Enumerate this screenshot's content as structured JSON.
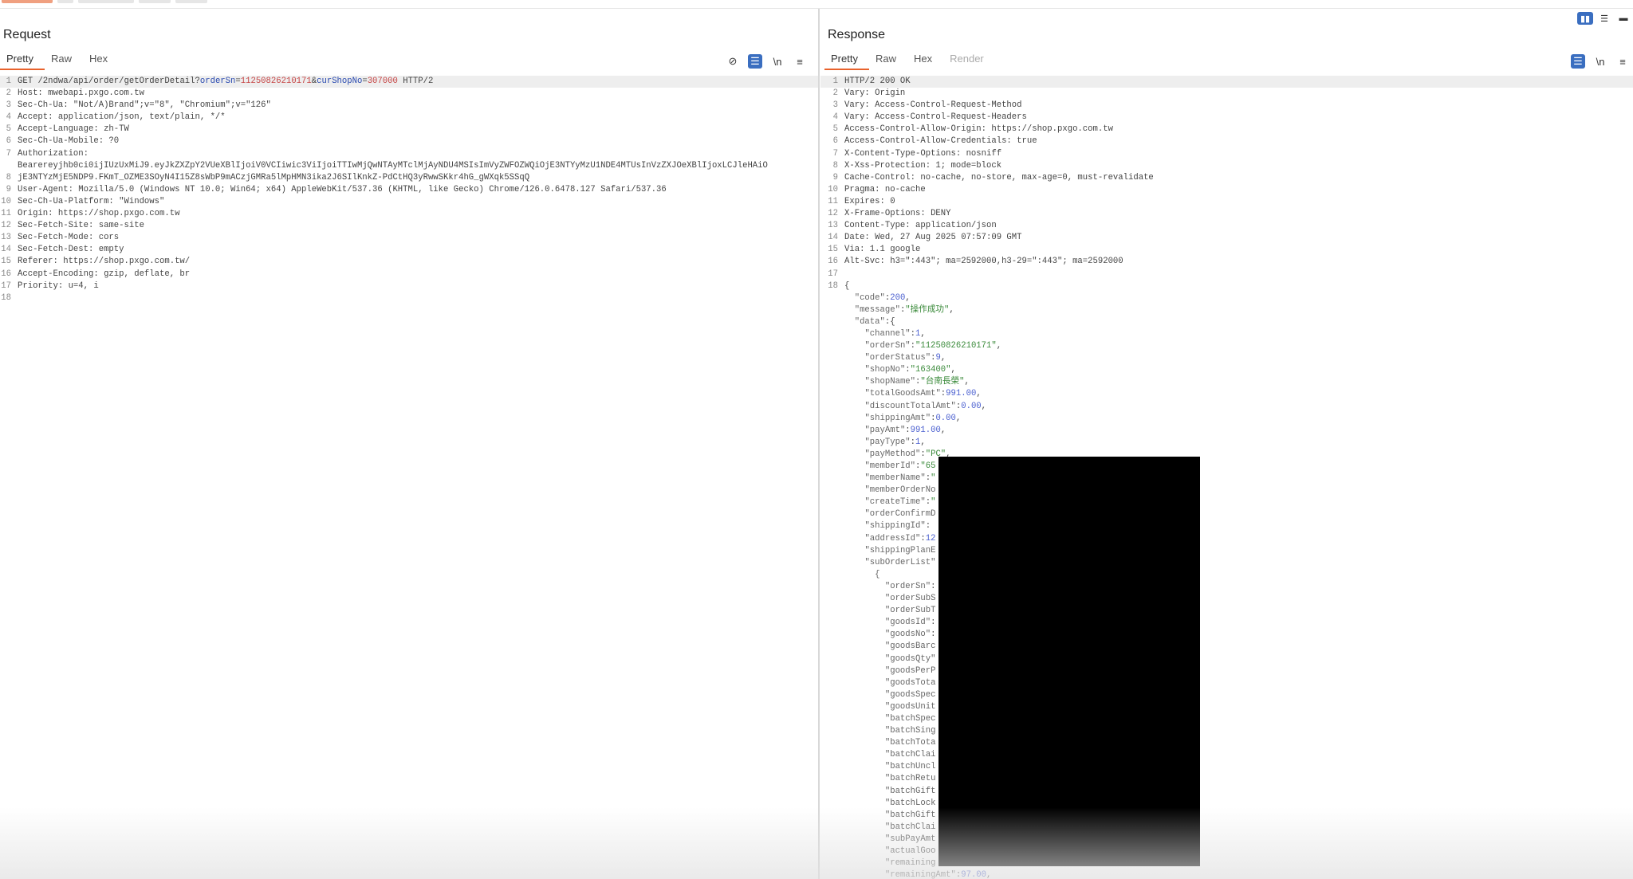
{
  "top_tabs": [
    "",
    "",
    "",
    "",
    ""
  ],
  "layout_buttons": [
    "▮▮",
    "☰",
    "▬"
  ],
  "request": {
    "title": "Request",
    "tabs": [
      "Pretty",
      "Raw",
      "Hex"
    ],
    "toolbar": [
      "⊘",
      "☰",
      "\\n",
      "≡"
    ],
    "request_line": {
      "method": "GET",
      "path": "/2ndwa/api/order/getOrderDetail?",
      "p1_key": "orderSn",
      "p1_val": "11250826210171",
      "p2_key": "curShopNo",
      "p2_val": "307000",
      "protocol": "HTTP/2"
    },
    "lines": [
      "Host: mwebapi.pxgo.com.tw",
      "Sec-Ch-Ua: \"Not/A)Brand\";v=\"8\", \"Chromium\";v=\"126\"",
      "Accept: application/json, text/plain, */*",
      "Accept-Language: zh-TW",
      "Sec-Ch-Ua-Mobile: ?0",
      "Authorization:",
      "Bearereyjhb0ci0ijIUzUxMiJ9.eyJkZXZpY2VUeXBlIjoiV0VCIiwic3ViIjoiTTIwMjQwNTAyMTclMjAyNDU4MSIsImVyZWFOZWQiOjE3NTYyMzU1NDE4MTUsInVzZXJOeXBlIjoxLCJleHAiO",
      "jE3NTYzMjE5NDP9.FKmT_OZME3SOyN4I15Z8sWbP9mACzjGMRa5lMpHMN3ika2J6SIlKnkZ-PdCtHQ3yRwwSKkr4hG_gWXqk5SSqQ",
      "User-Agent: Mozilla/5.0 (Windows NT 10.0; Win64; x64) AppleWebKit/537.36 (KHTML, like Gecko) Chrome/126.0.6478.127 Safari/537.36",
      "Sec-Ch-Ua-Platform: \"Windows\"",
      "Origin: https://shop.pxgo.com.tw",
      "Sec-Fetch-Site: same-site",
      "Sec-Fetch-Mode: cors",
      "Sec-Fetch-Dest: empty",
      "Referer: https://shop.pxgo.com.tw/",
      "Accept-Encoding: gzip, deflate, br",
      "Priority: u=4, i",
      "",
      ""
    ],
    "line_numbers": [
      "1",
      "2",
      "3",
      "4",
      "5",
      "6",
      "7",
      "",
      "8",
      "9",
      "10",
      "11",
      "12",
      "13",
      "14",
      "15",
      "16",
      "17",
      "18"
    ]
  },
  "response": {
    "title": "Response",
    "tabs": [
      "Pretty",
      "Raw",
      "Hex",
      "Render"
    ],
    "toolbar": [
      "☰",
      "\\n",
      "≡"
    ],
    "headers": [
      "HTTP/2 200 OK",
      "Vary: Origin",
      "Vary: Access-Control-Request-Method",
      "Vary: Access-Control-Request-Headers",
      "Access-Control-Allow-Origin: https://shop.pxgo.com.tw",
      "Access-Control-Allow-Credentials: true",
      "X-Content-Type-Options: nosniff",
      "X-Xss-Protection: 1; mode=block",
      "Cache-Control: no-cache, no-store, max-age=0, must-revalidate",
      "Pragma: no-cache",
      "Expires: 0",
      "X-Frame-Options: DENY",
      "Content-Type: application/json",
      "Date: Wed, 27 Aug 2025 07:57:09 GMT",
      "Via: 1.1 google",
      "Alt-Svc: h3=\":443\"; ma=2592000,h3-29=\":443\"; ma=2592000",
      "",
      "{"
    ],
    "json_lines": [
      {
        "indent": 1,
        "key": "\"code\"",
        "sep": ":",
        "val": "200",
        "t": "n",
        "end": ","
      },
      {
        "indent": 1,
        "key": "\"message\"",
        "sep": ":",
        "val": "\"操作成功\"",
        "t": "s",
        "end": ","
      },
      {
        "indent": 1,
        "key": "\"data\"",
        "sep": ":{",
        "val": "",
        "t": "",
        "end": ""
      },
      {
        "indent": 2,
        "key": "\"channel\"",
        "sep": ":",
        "val": "1",
        "t": "n",
        "end": ","
      },
      {
        "indent": 2,
        "key": "\"orderSn\"",
        "sep": ":",
        "val": "\"11250826210171\"",
        "t": "s",
        "end": ","
      },
      {
        "indent": 2,
        "key": "\"orderStatus\"",
        "sep": ":",
        "val": "9",
        "t": "n",
        "end": ","
      },
      {
        "indent": 2,
        "key": "\"shopNo\"",
        "sep": ":",
        "val": "\"163400\"",
        "t": "s",
        "end": ","
      },
      {
        "indent": 2,
        "key": "\"shopName\"",
        "sep": ":",
        "val": "\"台南長榮\"",
        "t": "s",
        "end": ","
      },
      {
        "indent": 2,
        "key": "\"totalGoodsAmt\"",
        "sep": ":",
        "val": "991.00",
        "t": "n",
        "end": ","
      },
      {
        "indent": 2,
        "key": "\"discountTotalAmt\"",
        "sep": ":",
        "val": "0.00",
        "t": "n",
        "end": ","
      },
      {
        "indent": 2,
        "key": "\"shippingAmt\"",
        "sep": ":",
        "val": "0.00",
        "t": "n",
        "end": ","
      },
      {
        "indent": 2,
        "key": "\"payAmt\"",
        "sep": ":",
        "val": "991.00",
        "t": "n",
        "end": ","
      },
      {
        "indent": 2,
        "key": "\"payType\"",
        "sep": ":",
        "val": "1",
        "t": "n",
        "end": ","
      },
      {
        "indent": 2,
        "key": "\"payMethod\"",
        "sep": ":",
        "val": "\"PC\"",
        "t": "s",
        "end": ","
      },
      {
        "indent": 2,
        "key": "\"memberId\"",
        "sep": ":",
        "val": "\"65",
        "t": "s",
        "end": ""
      },
      {
        "indent": 2,
        "key": "\"memberName\"",
        "sep": ":",
        "val": "\"",
        "t": "s",
        "end": ""
      },
      {
        "indent": 2,
        "key": "\"memberOrderNo",
        "sep": "",
        "val": "",
        "t": "",
        "end": ""
      },
      {
        "indent": 2,
        "key": "\"createTime\"",
        "sep": ":",
        "val": "\"",
        "t": "s",
        "end": ""
      },
      {
        "indent": 2,
        "key": "\"orderConfirmD",
        "sep": "",
        "val": "",
        "t": "",
        "end": ""
      },
      {
        "indent": 2,
        "key": "\"shippingId\"",
        "sep": ":",
        "val": "",
        "t": "",
        "end": ""
      },
      {
        "indent": 2,
        "key": "\"addressId\"",
        "sep": ":",
        "val": "12",
        "t": "n",
        "end": ""
      },
      {
        "indent": 2,
        "key": "\"shippingPlanE",
        "sep": "",
        "val": "",
        "t": "",
        "end": ""
      },
      {
        "indent": 2,
        "key": "\"subOrderList\"",
        "sep": "",
        "val": "",
        "t": "",
        "end": ""
      },
      {
        "indent": 3,
        "key": "{",
        "sep": "",
        "val": "",
        "t": "",
        "end": ""
      },
      {
        "indent": 4,
        "key": "\"orderSn\"",
        "sep": ":",
        "val": "",
        "t": "",
        "end": ""
      },
      {
        "indent": 4,
        "key": "\"orderSubS",
        "sep": "",
        "val": "",
        "t": "",
        "end": ""
      },
      {
        "indent": 4,
        "key": "\"orderSubT",
        "sep": "",
        "val": "",
        "t": "",
        "end": ""
      },
      {
        "indent": 4,
        "key": "\"goodsId\"",
        "sep": ":",
        "val": "",
        "t": "",
        "end": ""
      },
      {
        "indent": 4,
        "key": "\"goodsNo\"",
        "sep": ":",
        "val": "",
        "t": "",
        "end": ""
      },
      {
        "indent": 4,
        "key": "\"goodsBarc",
        "sep": "",
        "val": "",
        "t": "",
        "end": ""
      },
      {
        "indent": 4,
        "key": "\"goodsQty\"",
        "sep": "",
        "val": "",
        "t": "",
        "end": ""
      },
      {
        "indent": 4,
        "key": "\"goodsPerP",
        "sep": "",
        "val": "",
        "t": "",
        "end": ""
      },
      {
        "indent": 4,
        "key": "\"goodsTota",
        "sep": "",
        "val": "",
        "t": "",
        "end": ""
      },
      {
        "indent": 4,
        "key": "\"goodsSpec",
        "sep": "",
        "val": "",
        "t": "",
        "end": ""
      },
      {
        "indent": 4,
        "key": "\"goodsUnit",
        "sep": "",
        "val": "",
        "t": "",
        "end": ""
      },
      {
        "indent": 4,
        "key": "\"batchSpec",
        "sep": "",
        "val": "",
        "t": "",
        "end": ""
      },
      {
        "indent": 4,
        "key": "\"batchSing",
        "sep": "",
        "val": "",
        "t": "",
        "end": ""
      },
      {
        "indent": 4,
        "key": "\"batchTota",
        "sep": "",
        "val": "",
        "t": "",
        "end": ""
      },
      {
        "indent": 4,
        "key": "\"batchClai",
        "sep": "",
        "val": "",
        "t": "",
        "end": ""
      },
      {
        "indent": 4,
        "key": "\"batchUncl",
        "sep": "",
        "val": "",
        "t": "",
        "end": ""
      },
      {
        "indent": 4,
        "key": "\"batchRetu",
        "sep": "",
        "val": "",
        "t": "",
        "end": ""
      },
      {
        "indent": 4,
        "key": "\"batchGift",
        "sep": "",
        "val": "",
        "t": "",
        "end": ""
      },
      {
        "indent": 4,
        "key": "\"batchLock",
        "sep": "",
        "val": "",
        "t": "",
        "end": ""
      },
      {
        "indent": 4,
        "key": "\"batchGift",
        "sep": "",
        "val": "",
        "t": "",
        "end": ""
      },
      {
        "indent": 4,
        "key": "\"batchClai",
        "sep": "",
        "val": "",
        "t": "",
        "end": ""
      },
      {
        "indent": 4,
        "key": "\"subPayAmt",
        "sep": "",
        "val": "",
        "t": "",
        "end": ""
      },
      {
        "indent": 4,
        "key": "\"actualGoo",
        "sep": "",
        "val": "",
        "t": "",
        "end": ""
      },
      {
        "indent": 4,
        "key": "\"remaining",
        "sep": "",
        "val": "",
        "t": "",
        "end": ""
      },
      {
        "indent": 4,
        "key": "\"remainingAmt\"",
        "sep": ":",
        "val": "97.00",
        "t": "n",
        "end": ","
      }
    ]
  },
  "colors": {
    "accent": "#e8622c",
    "blue": "#3a6ec0",
    "string": "#3a8a3a",
    "number": "#4a5fd0",
    "param": "#c64545"
  }
}
